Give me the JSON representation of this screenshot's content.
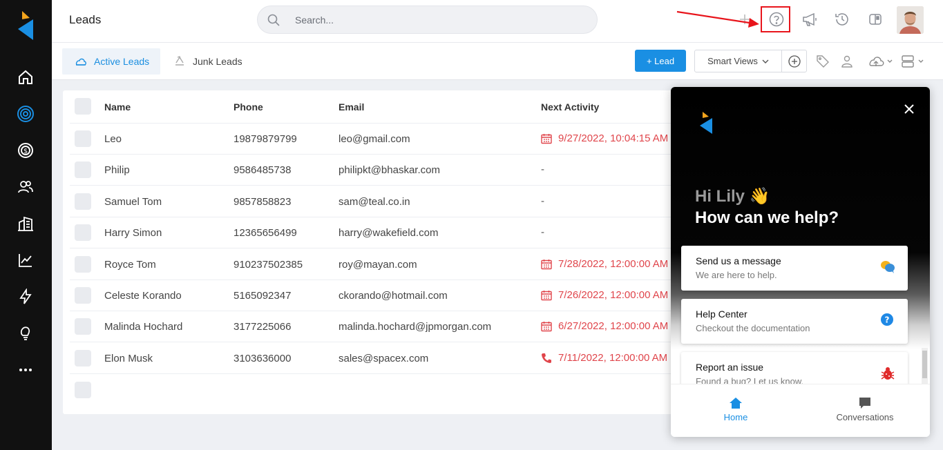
{
  "header": {
    "title": "Leads",
    "search_placeholder": "Search..."
  },
  "tabs": {
    "active": "Active Leads",
    "junk": "Junk Leads"
  },
  "toolbar": {
    "add_lead": "+ Lead",
    "smart_views": "Smart Views"
  },
  "table": {
    "columns": [
      "Name",
      "Phone",
      "Email",
      "Next Activity"
    ],
    "rows": [
      {
        "name": "Leo",
        "phone": "19879879799",
        "email": "leo@gmail.com",
        "activity": "9/27/2022, 10:04:15 AM",
        "activity_icon": "calendar-icon"
      },
      {
        "name": "Philip",
        "phone": "9586485738",
        "email": "philipkt@bhaskar.com",
        "activity": "-",
        "activity_icon": ""
      },
      {
        "name": "Samuel Tom",
        "phone": "9857858823",
        "email": "sam@teal.co.in",
        "activity": "-",
        "activity_icon": ""
      },
      {
        "name": "Harry Simon",
        "phone": "12365656499",
        "email": "harry@wakefield.com",
        "activity": "-",
        "activity_icon": ""
      },
      {
        "name": "Royce Tom",
        "phone": "910237502385",
        "email": "roy@mayan.com",
        "activity": "7/28/2022, 12:00:00 AM",
        "activity_icon": "calendar-icon"
      },
      {
        "name": "Celeste Korando",
        "phone": "5165092347",
        "email": "ckorando@hotmail.com",
        "activity": "7/26/2022, 12:00:00 AM",
        "activity_icon": "calendar-icon"
      },
      {
        "name": "Malinda Hochard",
        "phone": "3177225066",
        "email": "malinda.hochard@jpmorgan.com",
        "activity": "6/27/2022, 12:00:00 AM",
        "activity_icon": "calendar-icon"
      },
      {
        "name": "Elon Musk",
        "phone": "3103636000",
        "email": "sales@spacex.com",
        "activity": "7/11/2022, 12:00:00 AM",
        "activity_icon": "phone-icon"
      }
    ]
  },
  "help_panel": {
    "greeting": "Hi Lily 👋",
    "headline": "How can we help?",
    "cards": [
      {
        "title": "Send us a message",
        "subtitle": "We are here to help.",
        "icon": "chat-bubbles-icon"
      },
      {
        "title": "Help Center",
        "subtitle": "Checkout the documentation",
        "icon": "question-circle-icon"
      },
      {
        "title": "Report an issue",
        "subtitle": "Found a bug? Let us know.",
        "icon": "bug-icon"
      }
    ],
    "nav": {
      "home": "Home",
      "conversations": "Conversations"
    }
  },
  "colors": {
    "accent": "#1a8fe3",
    "activity_red": "#e0454b",
    "sidebar_bg": "#111111",
    "highlight_red": "#e8141b"
  }
}
